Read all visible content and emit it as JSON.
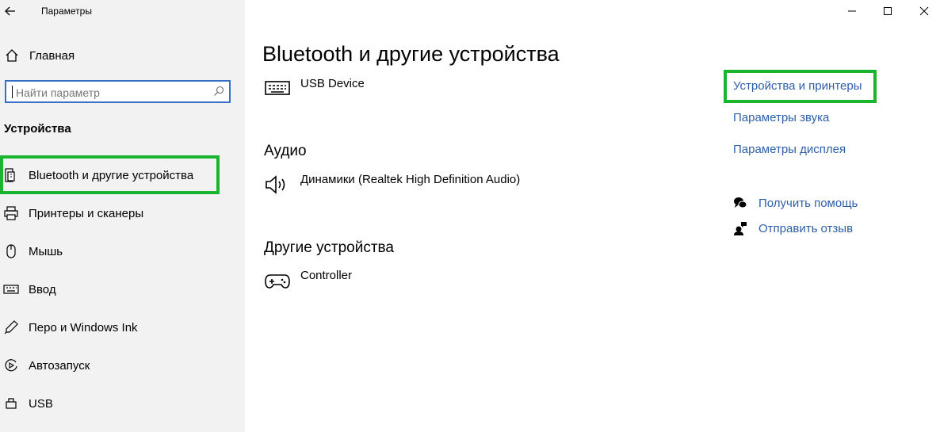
{
  "window": {
    "title": "Параметры"
  },
  "sidebar": {
    "home_label": "Главная",
    "search_placeholder": "Найти параметр",
    "section_title": "Устройства",
    "items": [
      {
        "label": "Bluetooth и другие устройства",
        "icon": "bluetooth-devices-icon",
        "selected": true
      },
      {
        "label": "Принтеры и сканеры",
        "icon": "printer-icon"
      },
      {
        "label": "Мышь",
        "icon": "mouse-icon"
      },
      {
        "label": "Ввод",
        "icon": "keyboard-icon"
      },
      {
        "label": "Перо и Windows Ink",
        "icon": "pen-icon"
      },
      {
        "label": "Автозапуск",
        "icon": "autoplay-icon"
      },
      {
        "label": "USB",
        "icon": "usb-icon"
      }
    ]
  },
  "main": {
    "title": "Bluetooth и другие устройства",
    "devices": {
      "keyboard": "USB Device",
      "audio_group": "Аудио",
      "speaker": "Динамики (Realtek High Definition Audio)",
      "other_group": "Другие устройства",
      "controller": "Controller"
    }
  },
  "related": {
    "links": [
      "Устройства и принтеры",
      "Параметры звука",
      "Параметры дисплея"
    ],
    "help": "Получить помощь",
    "feedback": "Отправить отзыв"
  },
  "colors": {
    "highlight": "#19b52e",
    "link": "#2e5fa8",
    "search_border": "#3770c6",
    "sidebar_bg": "#f2f2f2"
  }
}
